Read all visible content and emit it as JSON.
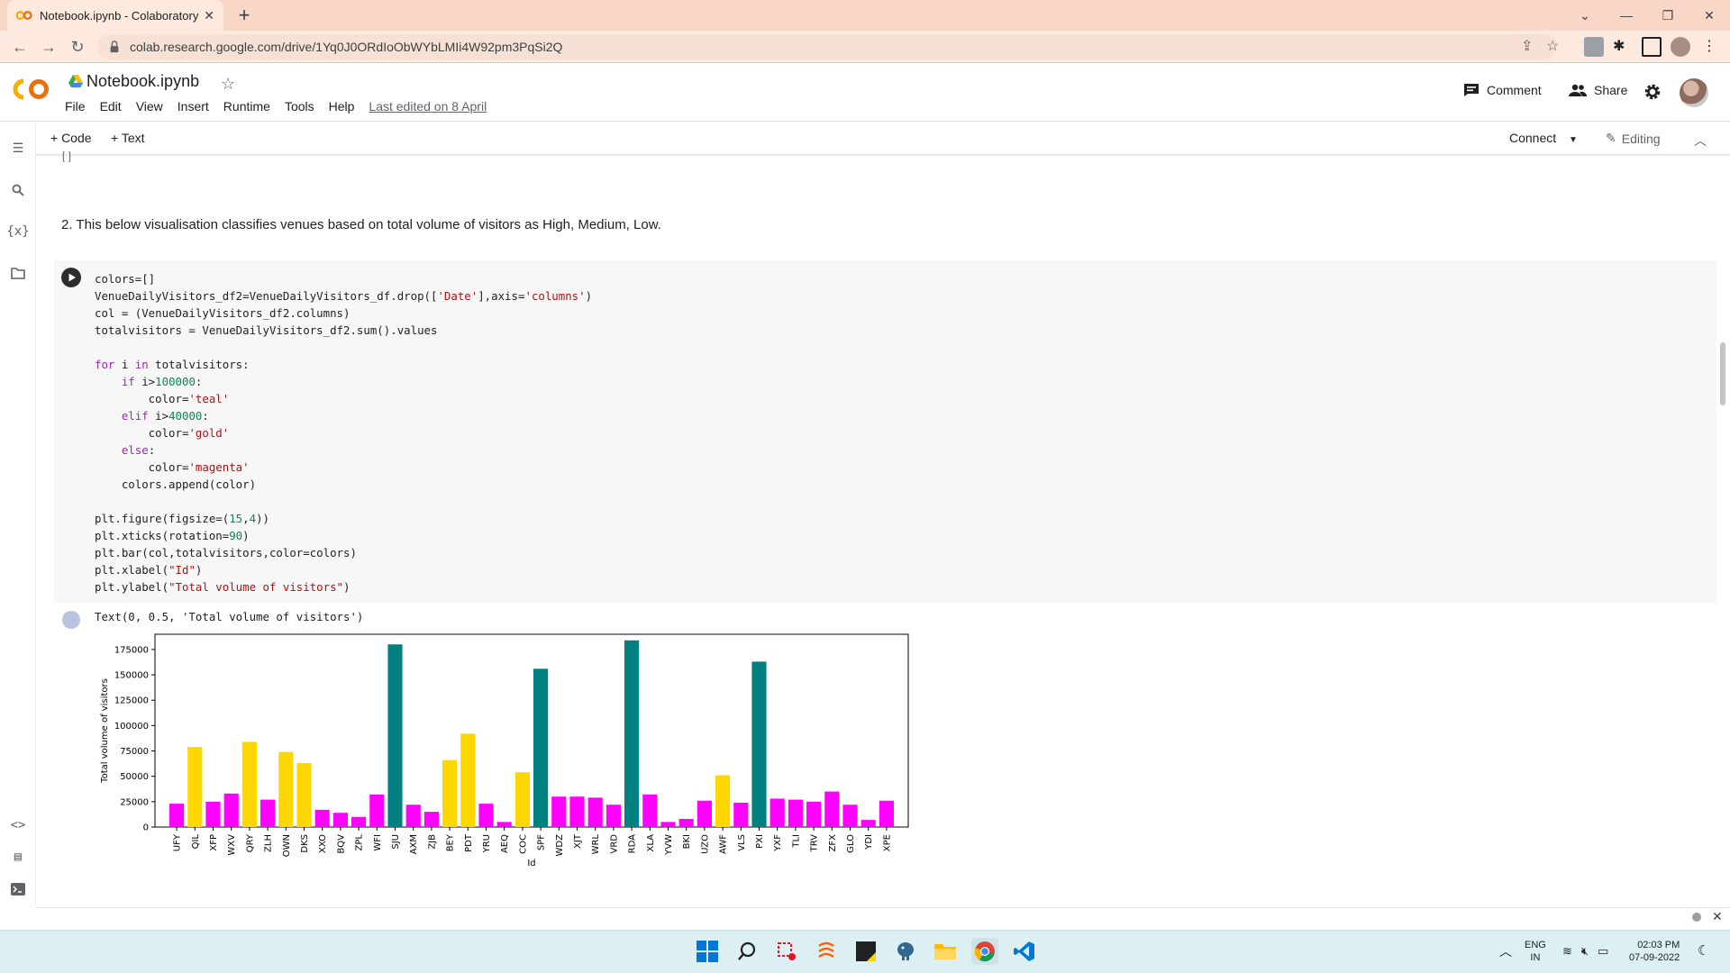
{
  "browser": {
    "tab_title": "Notebook.ipynb - Colaboratory",
    "url": "colab.research.google.com/drive/1Yq0J0ORdIoObWYbLMIi4W92pm3PqSi2Q"
  },
  "notebook": {
    "title": "Notebook.ipynb",
    "menu": [
      "File",
      "Edit",
      "View",
      "Insert",
      "Runtime",
      "Tools",
      "Help"
    ],
    "last_edited": "Last edited on 8 April",
    "comment_label": "Comment",
    "share_label": "Share"
  },
  "cell_toolbar": {
    "add_code": "+ Code",
    "add_text": "+ Text",
    "connect": "Connect",
    "editing": "Editing"
  },
  "markdown": {
    "text": "2. This below visualisation classifies venues based on total volume of visitors as High, Medium, Low."
  },
  "code_lines": [
    "colors=[]",
    "VenueDailyVisitors_df2=VenueDailyVisitors_df.drop(['Date'],axis='columns')",
    "col = (VenueDailyVisitors_df2.columns)",
    "totalvisitors = VenueDailyVisitors_df2.sum().values",
    "",
    "for i in totalvisitors:",
    "    if i>100000:",
    "        color='teal'",
    "    elif i>40000:",
    "        color='gold'",
    "    else:",
    "        color='magenta'",
    "    colors.append(color)",
    "",
    "plt.figure(figsize=(15,4))",
    "plt.xticks(rotation=90)",
    "plt.bar(col,totalvisitors,color=colors)",
    "plt.xlabel(\"Id\")",
    "plt.ylabel(\"Total volume of visitors\")"
  ],
  "output_text": "Text(0, 0.5, 'Total volume of visitors')",
  "chart_data": {
    "type": "bar",
    "categories": [
      "UFY",
      "QIL",
      "XFP",
      "WXV",
      "QRY",
      "ZLH",
      "OWN",
      "DKS",
      "XXO",
      "BQV",
      "ZPL",
      "WFI",
      "SJU",
      "AXM",
      "ZJB",
      "BEY",
      "PDT",
      "YRU",
      "AEQ",
      "COC",
      "SPF",
      "WDZ",
      "XJT",
      "WRL",
      "VRD",
      "RDA",
      "XLA",
      "YVW",
      "BKI",
      "UZO",
      "AWF",
      "VLS",
      "PXI",
      "YXF",
      "TLI",
      "TRV",
      "ZFX",
      "GLO",
      "YDI",
      "XPE"
    ],
    "values": [
      23000,
      79000,
      25000,
      33000,
      84000,
      27000,
      74000,
      63000,
      17000,
      14000,
      10000,
      32000,
      180000,
      22000,
      15000,
      66000,
      92000,
      23000,
      5000,
      54000,
      156000,
      30000,
      30000,
      29000,
      22000,
      184000,
      32000,
      5000,
      8000,
      26000,
      51000,
      24000,
      163000,
      28000,
      27000,
      25000,
      35000,
      22000,
      7000,
      26000
    ],
    "colors": [
      "#ff00ff",
      "#ffd700",
      "#ff00ff",
      "#ff00ff",
      "#ffd700",
      "#ff00ff",
      "#ffd700",
      "#ffd700",
      "#ff00ff",
      "#ff00ff",
      "#ff00ff",
      "#ff00ff",
      "#008080",
      "#ff00ff",
      "#ff00ff",
      "#ffd700",
      "#ffd700",
      "#ff00ff",
      "#ff00ff",
      "#ffd700",
      "#008080",
      "#ff00ff",
      "#ff00ff",
      "#ff00ff",
      "#ff00ff",
      "#008080",
      "#ff00ff",
      "#ff00ff",
      "#ff00ff",
      "#ff00ff",
      "#ffd700",
      "#ff00ff",
      "#008080",
      "#ff00ff",
      "#ff00ff",
      "#ff00ff",
      "#ff00ff",
      "#ff00ff",
      "#ff00ff",
      "#ff00ff"
    ],
    "yticks": [
      0,
      25000,
      50000,
      75000,
      100000,
      125000,
      150000,
      175000
    ],
    "ylim": [
      0,
      190000
    ],
    "xlabel": "Id",
    "ylabel": "Total volume of visitors"
  },
  "taskbar": {
    "lang": [
      "ENG",
      "IN"
    ],
    "time": "02:03 PM",
    "date": "07-09-2022"
  }
}
